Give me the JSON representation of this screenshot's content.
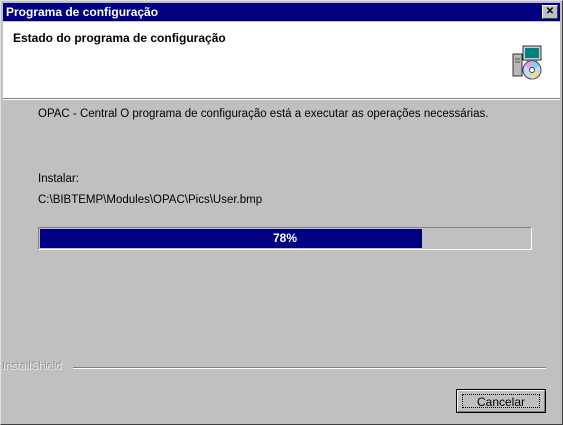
{
  "window": {
    "title": "Programa de configuração",
    "close_glyph": "✕"
  },
  "header": {
    "title": "Estado do programa de configuração",
    "icon": "setup-computer-cd-icon"
  },
  "main": {
    "status_text": "OPAC - Central O programa de configuração está a executar as operações necessárias.",
    "install_label": "Instalar:",
    "file_path": "C:\\BIBTEMP\\Modules\\OPAC\\Pics\\User.bmp",
    "progress": {
      "value": 0.78,
      "label": "78%"
    }
  },
  "footer": {
    "brand": "InstallShield",
    "cancel_label": "Cancelar"
  },
  "colors": {
    "titlebar": "#000080",
    "progress_fill": "#000080",
    "face": "#c0c0c0"
  }
}
